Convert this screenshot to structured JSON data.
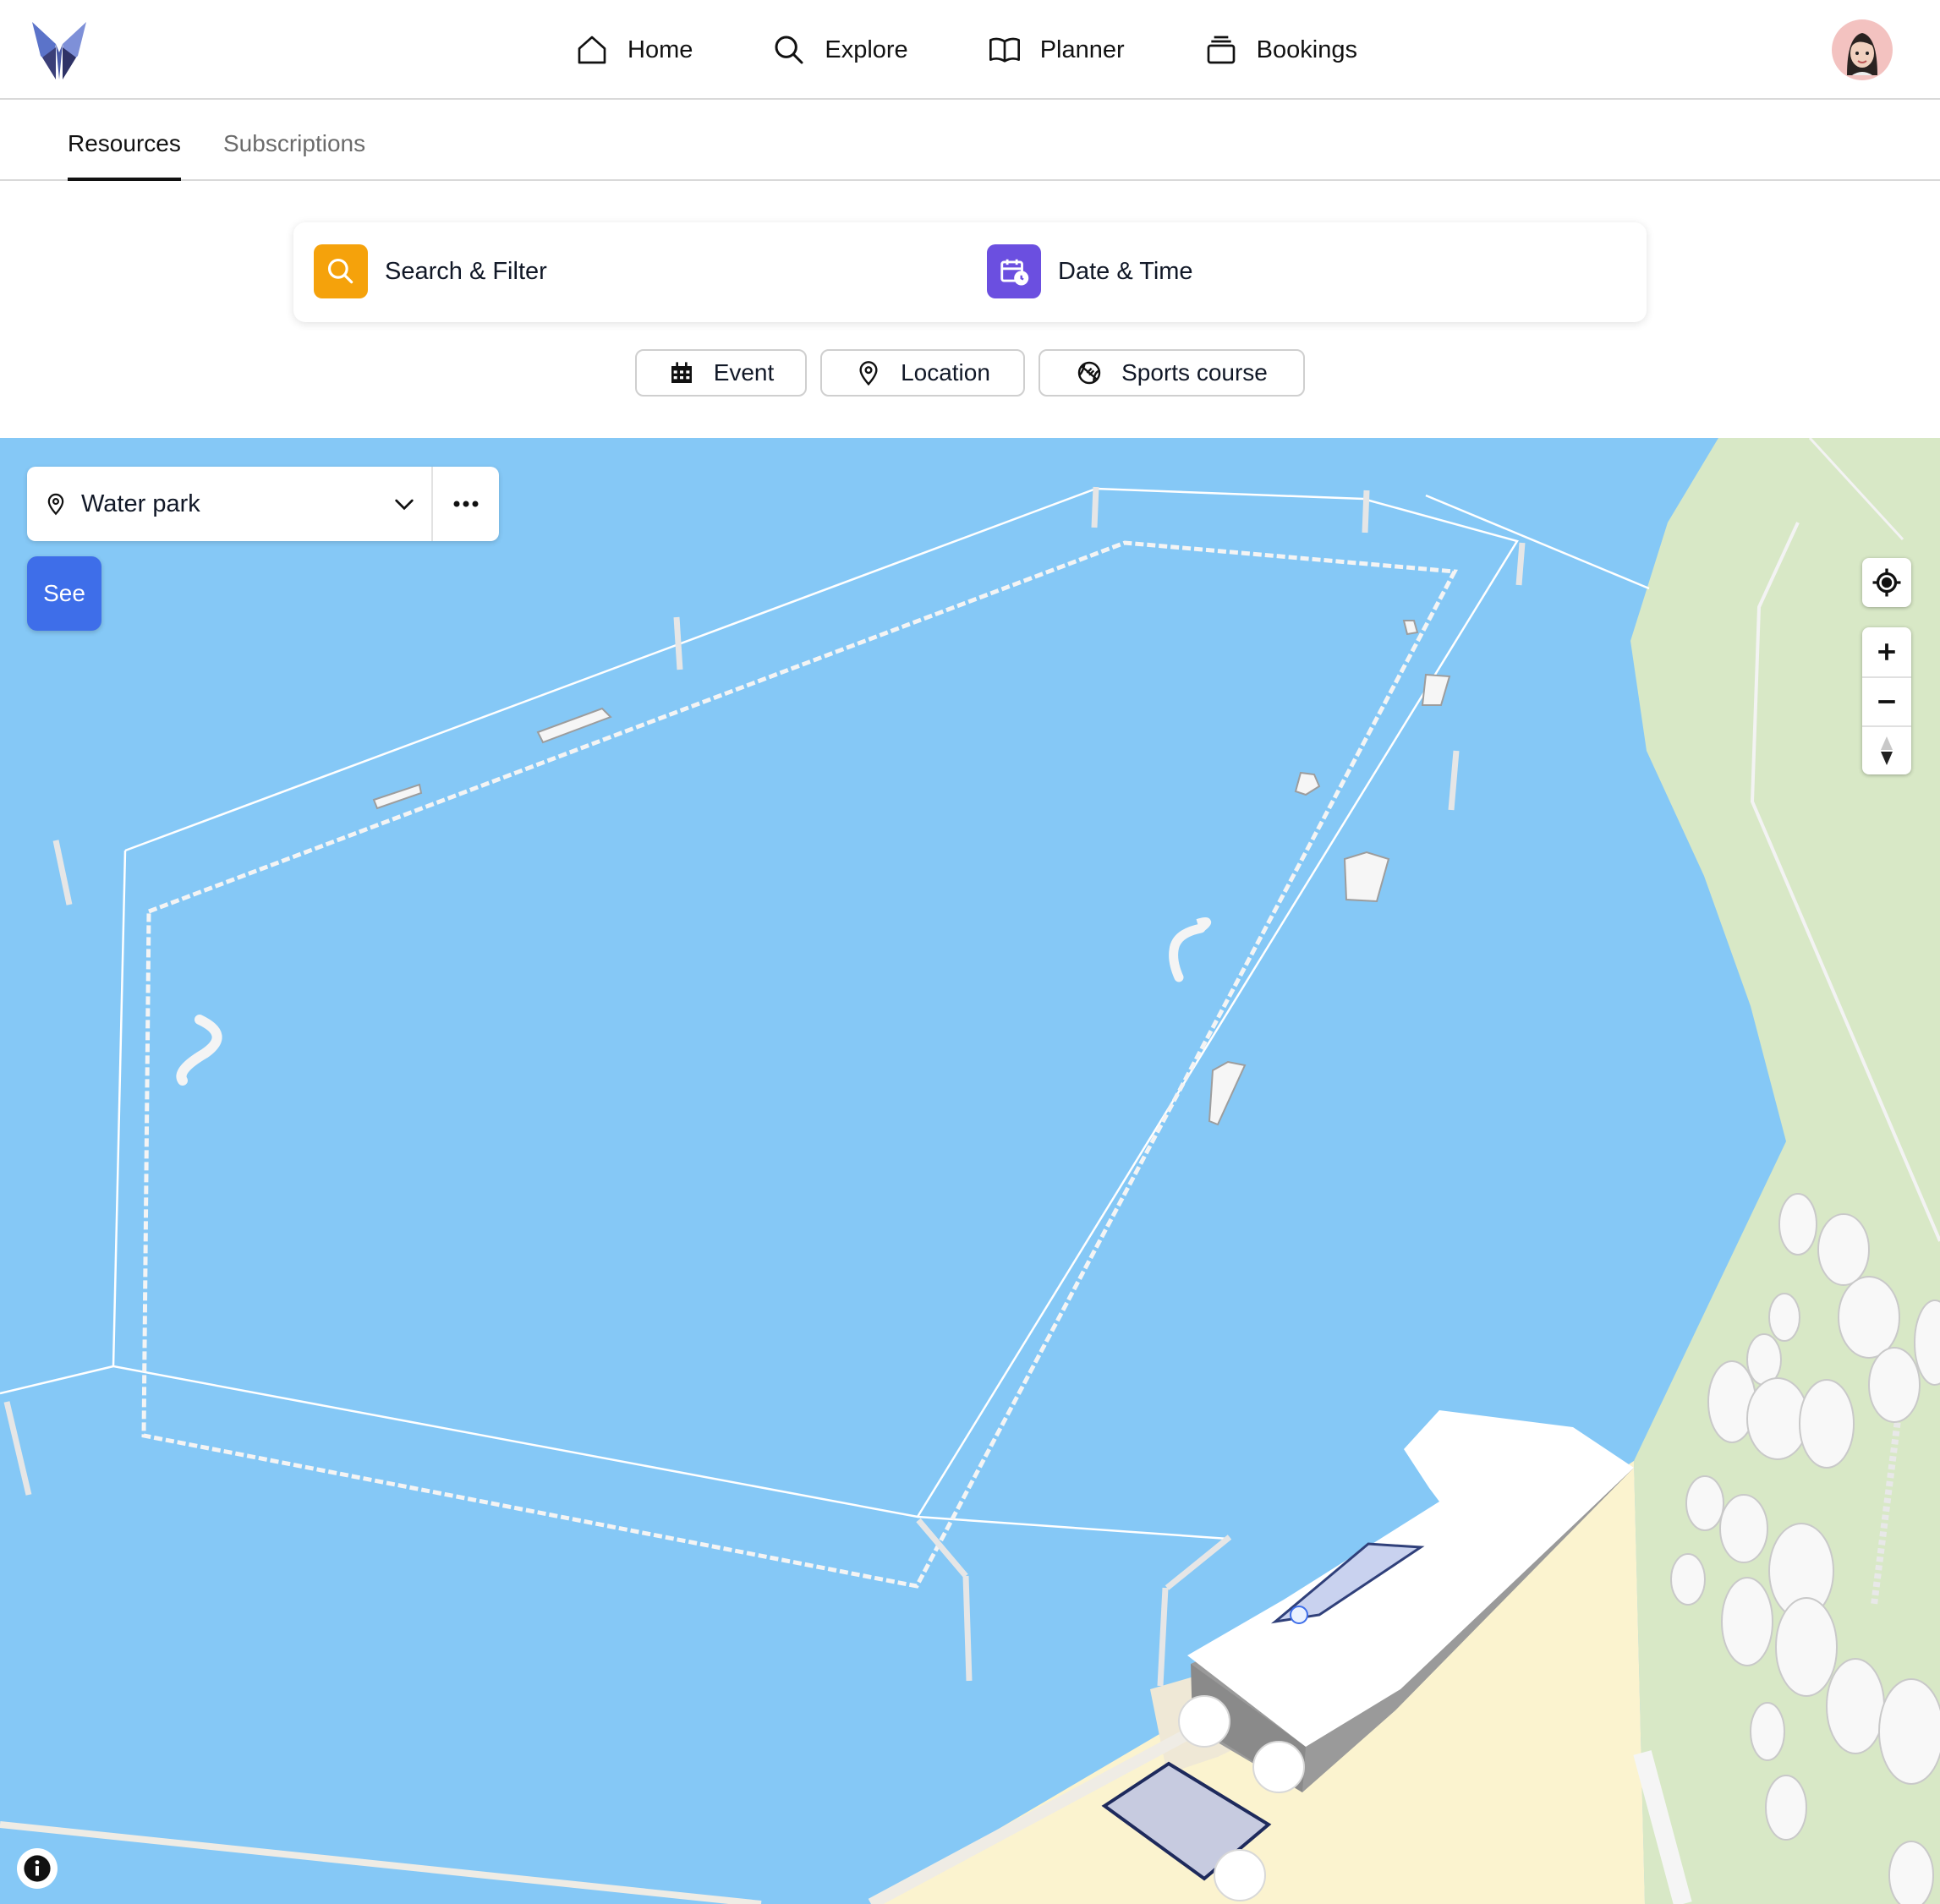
{
  "nav": {
    "items": [
      {
        "label": "Home",
        "icon": "home-icon"
      },
      {
        "label": "Explore",
        "icon": "search-icon"
      },
      {
        "label": "Planner",
        "icon": "book-icon"
      },
      {
        "label": "Bookings",
        "icon": "stack-icon"
      }
    ]
  },
  "tabs": [
    {
      "label": "Resources",
      "active": true
    },
    {
      "label": "Subscriptions",
      "active": false
    }
  ],
  "search_card": {
    "search_label": "Search & Filter",
    "date_label": "Date & Time",
    "search_color": "#f5a20b",
    "date_color": "#6b4fe0"
  },
  "chips": [
    {
      "label": "Event",
      "icon": "calendar-grid-icon"
    },
    {
      "label": "Location",
      "icon": "map-pin-icon"
    },
    {
      "label": "Sports course",
      "icon": "ball-icon"
    }
  ],
  "map": {
    "location_select": "Water park",
    "see_button": "See",
    "water_color": "#85c8f6",
    "grass_color": "#d8e8c6",
    "sand_color": "#fbf3cf",
    "accent_color": "#3e6ee9"
  }
}
